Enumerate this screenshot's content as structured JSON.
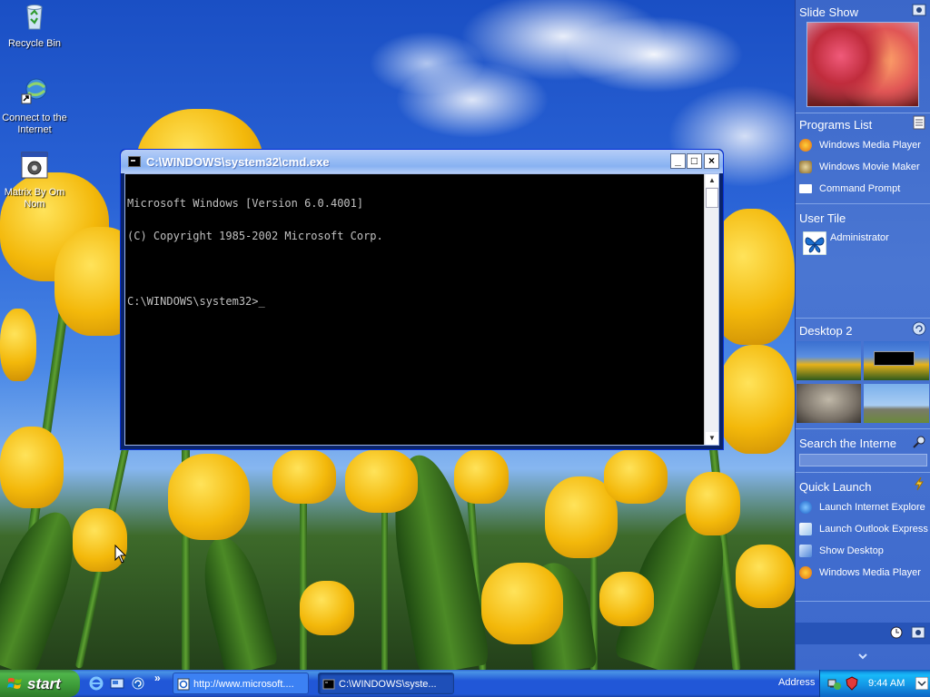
{
  "desktop": {
    "icons": [
      {
        "label": "Recycle Bin",
        "icon": "recycle-bin-icon"
      },
      {
        "label": "Connect to the Internet",
        "icon": "internet-connect-icon"
      },
      {
        "label": "Matrix By Om Nom",
        "icon": "application-icon"
      }
    ]
  },
  "cmd": {
    "title": "C:\\WINDOWS\\system32\\cmd.exe",
    "lines": [
      "Microsoft Windows [Version 6.0.4001]",
      "(C) Copyright 1985-2002 Microsoft Corp.",
      "",
      "C:\\WINDOWS\\system32>_"
    ],
    "min_label": "_",
    "max_label": "□",
    "close_label": "×"
  },
  "sidebar": {
    "slideshow": {
      "title": "Slide Show"
    },
    "programs": {
      "title": "Programs List",
      "items": [
        "Windows Media Player",
        "Windows Movie Maker",
        "Command Prompt"
      ]
    },
    "user": {
      "title": "User Tile",
      "name": "Administrator"
    },
    "desktop2": {
      "title": "Desktop 2"
    },
    "search": {
      "title": "Search the Interne"
    },
    "quicklaunch": {
      "title": "Quick Launch",
      "items": [
        "Launch Internet Explore",
        "Launch Outlook Express",
        "Show Desktop",
        "Windows Media Player"
      ]
    }
  },
  "taskbar": {
    "start_label": "start",
    "overflow_label": "»",
    "tasks": [
      {
        "label": "http://www.microsoft...."
      },
      {
        "label": "C:\\WINDOWS\\syste..."
      }
    ],
    "address_label": "Address",
    "clock": "9:44 AM"
  },
  "colors": {
    "taskbar_blue": "#2157d7",
    "start_green": "#3c9a38",
    "sidebar_blue": "#4a76d2",
    "console_text": "#c0c0c0"
  }
}
